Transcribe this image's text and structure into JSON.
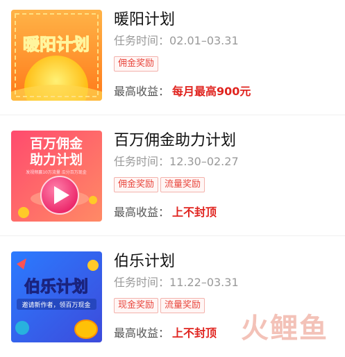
{
  "plans": [
    {
      "title": "暖阳计划",
      "period_label": "任务时间：",
      "period": "02.01–03.31",
      "tags": [
        "佣金奖励"
      ],
      "income_label": "最高收益：",
      "income_value": "每月最高900元",
      "thumb_text": "暖阳计划",
      "thumb_theme": "sun"
    },
    {
      "title": "百万佣金助力计划",
      "period_label": "任务时间：",
      "period": "12.30–02.27",
      "tags": [
        "佣金奖励",
        "流量奖励"
      ],
      "income_label": "最高收益：",
      "income_value": "上不封顶",
      "thumb_text_1": "百万佣金",
      "thumb_text_2": "助力计划",
      "thumb_sub": "发视频赢10万流量 瓜分百万现金",
      "thumb_theme": "play"
    },
    {
      "title": "伯乐计划",
      "period_label": "任务时间：",
      "period": "11.22–03.31",
      "tags": [
        "现金奖励",
        "流量奖励"
      ],
      "income_label": "最高收益：",
      "income_value": "上不封顶",
      "thumb_text": "伯乐计划",
      "thumb_sub": "邀请新作者，领百万现金",
      "thumb_theme": "blue"
    }
  ],
  "watermark": "火鲤鱼",
  "colors": {
    "accent_red": "#e0241f",
    "tag_border": "#f3b1ab"
  }
}
